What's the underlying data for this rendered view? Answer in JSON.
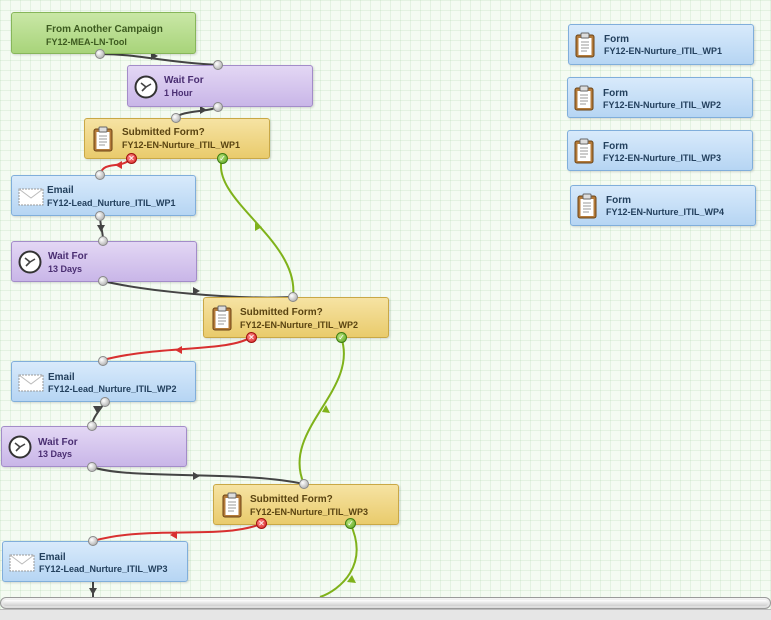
{
  "flow": {
    "from_campaign": {
      "title": "From Another Campaign",
      "sub": "FY12-MEA-LN-Tool"
    },
    "wait1": {
      "title": "Wait For",
      "sub": "1 Hour"
    },
    "submitted1": {
      "title": "Submitted Form?",
      "sub": "FY12-EN-Nurture_ITIL_WP1"
    },
    "email1": {
      "title": "Email",
      "sub": "FY12-Lead_Nurture_ITIL_WP1"
    },
    "wait2": {
      "title": "Wait For",
      "sub": "13 Days"
    },
    "submitted2": {
      "title": "Submitted Form?",
      "sub": "FY12-EN-Nurture_ITIL_WP2"
    },
    "email2": {
      "title": "Email",
      "sub": "FY12-Lead_Nurture_ITIL_WP2"
    },
    "wait3": {
      "title": "Wait For",
      "sub": "13 Days"
    },
    "submitted3": {
      "title": "Submitted Form?",
      "sub": "FY12-EN-Nurture_ITIL_WP3"
    },
    "email3": {
      "title": "Email",
      "sub": "FY12-Lead_Nurture_ITIL_WP3"
    }
  },
  "forms": [
    {
      "title": "Form",
      "sub": "FY12-EN-Nurture_ITIL_WP1"
    },
    {
      "title": "Form",
      "sub": "FY12-EN-Nurture_ITIL_WP2"
    },
    {
      "title": "Form",
      "sub": "FY12-EN-Nurture_ITIL_WP3"
    },
    {
      "title": "Form",
      "sub": "FY12-EN-Nurture_ITIL_WP4"
    }
  ],
  "colors": {
    "yes_path": "#7fb21a",
    "no_path": "#d83030",
    "default_path": "#444444"
  },
  "icons": {
    "wait": "clock-icon",
    "submitted": "clipboard-icon",
    "email": "envelope-icon",
    "form": "clipboard-icon"
  }
}
